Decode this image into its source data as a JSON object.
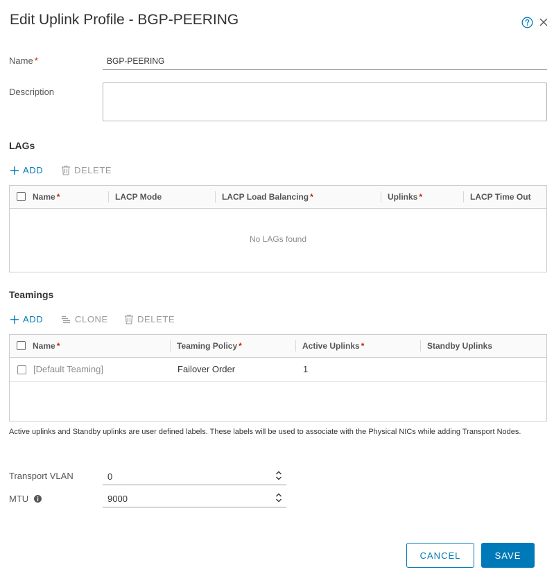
{
  "dialog": {
    "title": "Edit Uplink Profile - BGP-PEERING"
  },
  "form": {
    "name_label": "Name",
    "required_mark": "*",
    "name_value": "BGP-PEERING",
    "description_label": "Description",
    "description_value": ""
  },
  "lags": {
    "section_title": "LAGs",
    "add_label": "ADD",
    "delete_label": "DELETE",
    "columns": {
      "name": "Name",
      "lacp_mode": "LACP Mode",
      "lacp_load_balancing": "LACP Load Balancing",
      "uplinks": "Uplinks",
      "lacp_time_out": "LACP Time Out"
    },
    "empty_message": "No LAGs found"
  },
  "teamings": {
    "section_title": "Teamings",
    "add_label": "ADD",
    "clone_label": "CLONE",
    "delete_label": "DELETE",
    "columns": {
      "name": "Name",
      "teaming_policy": "Teaming Policy",
      "active_uplinks": "Active Uplinks",
      "standby_uplinks": "Standby Uplinks"
    },
    "rows": [
      {
        "name": "[Default Teaming]",
        "teaming_policy": "Failover Order",
        "active_uplinks": "1",
        "standby_uplinks": ""
      }
    ],
    "helper_text": "Active uplinks and Standby uplinks are user defined labels. These labels will be used to associate with the Physical NICs while adding Transport Nodes."
  },
  "transport_vlan": {
    "label": "Transport VLAN",
    "value": "0"
  },
  "mtu": {
    "label": "MTU",
    "value": "9000"
  },
  "footer": {
    "cancel_label": "CANCEL",
    "save_label": "SAVE"
  },
  "colors": {
    "accent": "#0079b8",
    "required": "#c92100",
    "disabled": "#9a9a9a"
  },
  "icons": {
    "help": "help-circle-icon",
    "close": "close-icon",
    "add": "plus-icon",
    "delete": "trash-icon",
    "clone": "clone-icon",
    "info": "info-circle-icon",
    "spinner": "spinner-arrows-icon"
  }
}
